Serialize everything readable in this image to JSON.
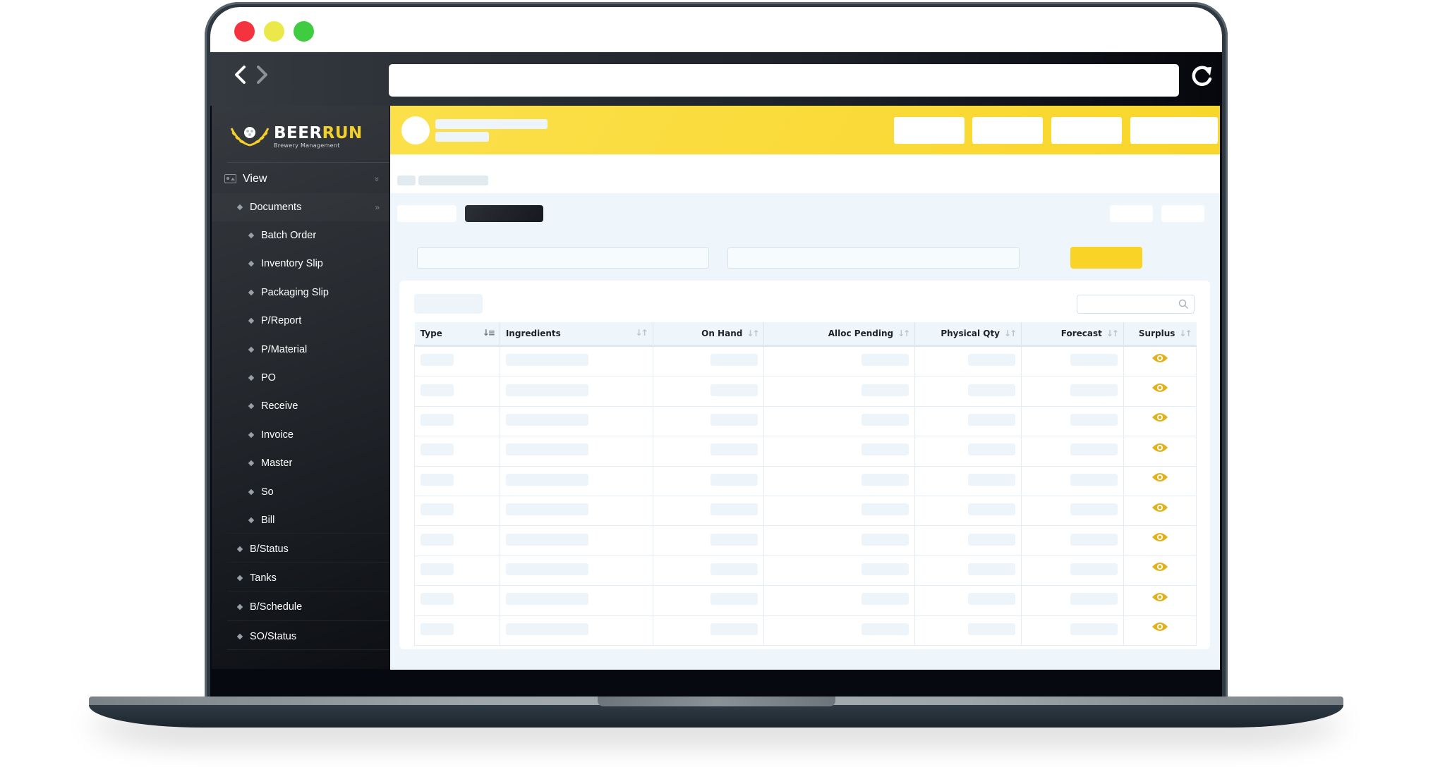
{
  "window": {
    "traffic_lights": [
      {
        "name": "close",
        "color": "#f5333f"
      },
      {
        "name": "minimize",
        "color": "#ebe84a"
      },
      {
        "name": "maximize",
        "color": "#40cc40"
      }
    ],
    "nav": {
      "back_icon": "‹",
      "forward_icon": "›"
    },
    "url": "",
    "reload_icon": "reload-icon"
  },
  "brand": {
    "name_part1": "BEER",
    "name_part2": "RUN",
    "tagline": "Brewery Management",
    "accent": "#f2cf2a"
  },
  "sidebar": {
    "section_label": "View",
    "section_chevron": "»",
    "documents_label": "Documents",
    "documents_chevron": "»",
    "document_items": [
      {
        "label": "Batch Order"
      },
      {
        "label": "Inventory Slip"
      },
      {
        "label": "Packaging Slip"
      },
      {
        "label": "P/Report"
      },
      {
        "label": "P/Material"
      },
      {
        "label": "PO"
      },
      {
        "label": "Receive"
      },
      {
        "label": "Invoice"
      },
      {
        "label": "Master"
      },
      {
        "label": "So"
      },
      {
        "label": "Bill"
      }
    ],
    "top_items": [
      {
        "label": "B/Status"
      },
      {
        "label": "Tanks"
      },
      {
        "label": "B/Schedule"
      },
      {
        "label": "SO/Status"
      }
    ]
  },
  "header": {
    "accent": "#f9d62b",
    "action_buttons": 4
  },
  "table": {
    "columns": [
      {
        "label": "Type",
        "sort_icon": "↓≡",
        "align": "left"
      },
      {
        "label": "Ingredients",
        "sort_icon": "↓↑",
        "align": "left"
      },
      {
        "label": "On Hand",
        "sort_icon": "↓↑",
        "align": "right"
      },
      {
        "label": "Alloc Pending",
        "sort_icon": "↓↑",
        "align": "right"
      },
      {
        "label": "Physical Qty",
        "sort_icon": "↓↑",
        "align": "right"
      },
      {
        "label": "Forecast",
        "sort_icon": "↓↑",
        "align": "right"
      },
      {
        "label": "Surplus",
        "sort_icon": "↓↑",
        "align": "center"
      }
    ],
    "row_count": 10,
    "row_action_icon": "eye-icon",
    "row_action_color": "#e2b21d"
  },
  "search": {
    "placeholder": ""
  }
}
